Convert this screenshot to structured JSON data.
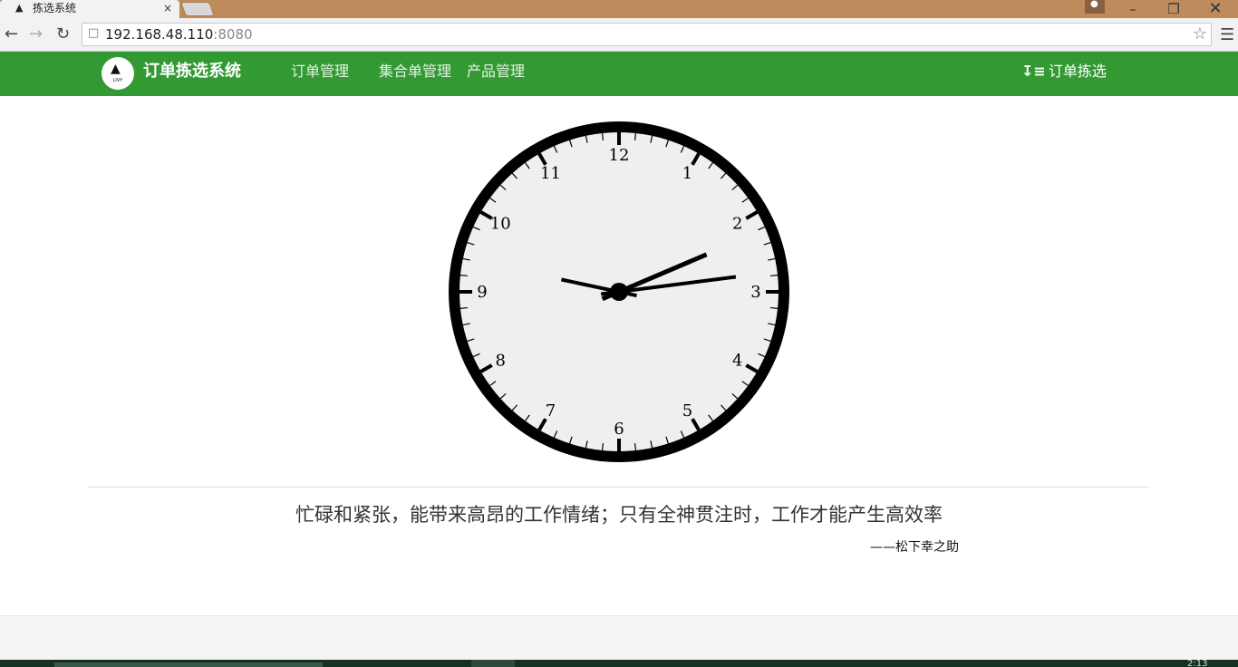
{
  "browser": {
    "tab_title": "拣选系统",
    "tab_close": "×",
    "url_host": "192.168.48.110",
    "url_port": ":8080",
    "icons": [
      "back-icon",
      "forward-icon",
      "reload-icon",
      "page-icon",
      "star-icon",
      "menu-icon",
      "close-icon",
      "minimize-icon",
      "restore-icon",
      "user-icon"
    ]
  },
  "navbar": {
    "logo_text": "LIVY",
    "brand": "订单拣选系统",
    "links": [
      "订单管理",
      "集合单管理",
      "产品管理"
    ],
    "right_link": "订单拣选",
    "color": "#339933"
  },
  "clock": {
    "numerals": [
      "12",
      "1",
      "2",
      "3",
      "4",
      "5",
      "6",
      "7",
      "8",
      "9",
      "10",
      "11"
    ],
    "hour": 2,
    "minute": 13,
    "second": 47,
    "face_color": "#efefef",
    "rim_color": "#000000"
  },
  "quote": {
    "text": "忙碌和紧张，能带来高昂的工作情绪；只有全神贯注时，工作才能产生高效率",
    "author": "——松下幸之助"
  },
  "taskbar": {
    "time": "2:13"
  }
}
